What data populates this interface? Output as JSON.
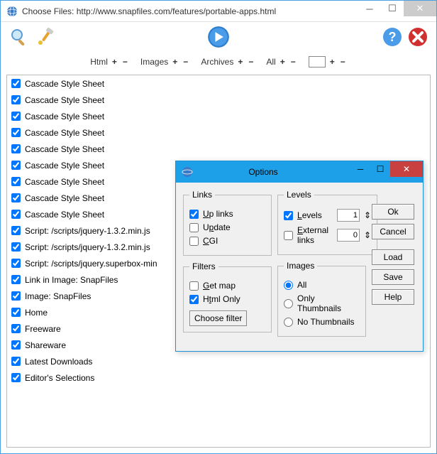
{
  "window": {
    "title": "Choose Files: http://www.snapfiles.com/features/portable-apps.html"
  },
  "filterbar": {
    "html": "Html",
    "images": "Images",
    "archives": "Archives",
    "all": "All"
  },
  "list": [
    "Cascade Style Sheet",
    "Cascade Style Sheet",
    "Cascade Style Sheet",
    "Cascade Style Sheet",
    "Cascade Style Sheet",
    "Cascade Style Sheet",
    "Cascade Style Sheet",
    "Cascade Style Sheet",
    "Cascade Style Sheet",
    "Script: /scripts/jquery-1.3.2.min.js",
    "Script: /scripts/jquery-1.3.2.min.js",
    "Script: /scripts/jquery.superbox-min",
    "Link in Image: SnapFiles",
    "Image: SnapFiles",
    "Home",
    "Freeware",
    "Shareware",
    "Latest Downloads",
    "Editor's Selections"
  ],
  "dialog": {
    "title": "Options",
    "links": {
      "legend": "Links",
      "uplinks": "Up links",
      "update": "Update",
      "cgi": "CGI"
    },
    "levels": {
      "legend": "Levels",
      "levels_lbl": "Levels",
      "levels_val": "1",
      "ext_lbl": "External links",
      "ext_val": "0"
    },
    "filters": {
      "legend": "Filters",
      "getmap": "Get map",
      "htmlonly": "Html Only",
      "choose": "Choose filter"
    },
    "images": {
      "legend": "Images",
      "all": "All",
      "onlythumbs": "Only Thumbnails",
      "nothumbs": "No Thumbnails"
    },
    "buttons": {
      "ok": "Ok",
      "cancel": "Cancel",
      "load": "Load",
      "save": "Save",
      "help": "Help"
    }
  }
}
